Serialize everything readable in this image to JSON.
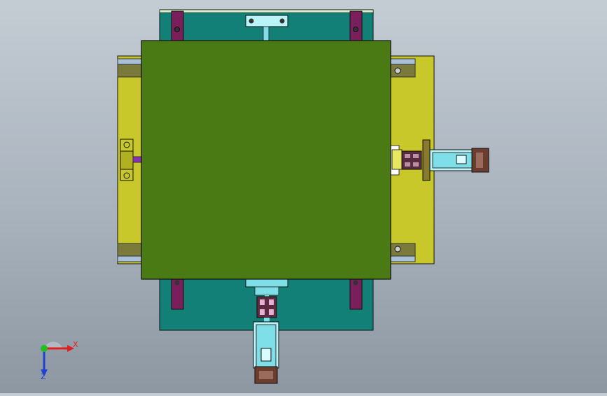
{
  "viewport": {
    "background_top": "#c4ccd4",
    "background_bottom": "#8c97a2"
  },
  "colors": {
    "main_plate": "#4a7a14",
    "teal_plate": "#138077",
    "yellow_plate": "#c9c82a",
    "purple_rail": "#7a1f5c",
    "cyan_part": "#7fdfe8",
    "coupling_purple": "#5a2b3f",
    "motor_brown": "#6a3d2e",
    "edge": "#1a1a1a"
  },
  "triad": {
    "x_label": "X",
    "z_label": "Z",
    "x_color": "#e02020",
    "y_color": "#20c020",
    "z_color": "#2040d0"
  }
}
